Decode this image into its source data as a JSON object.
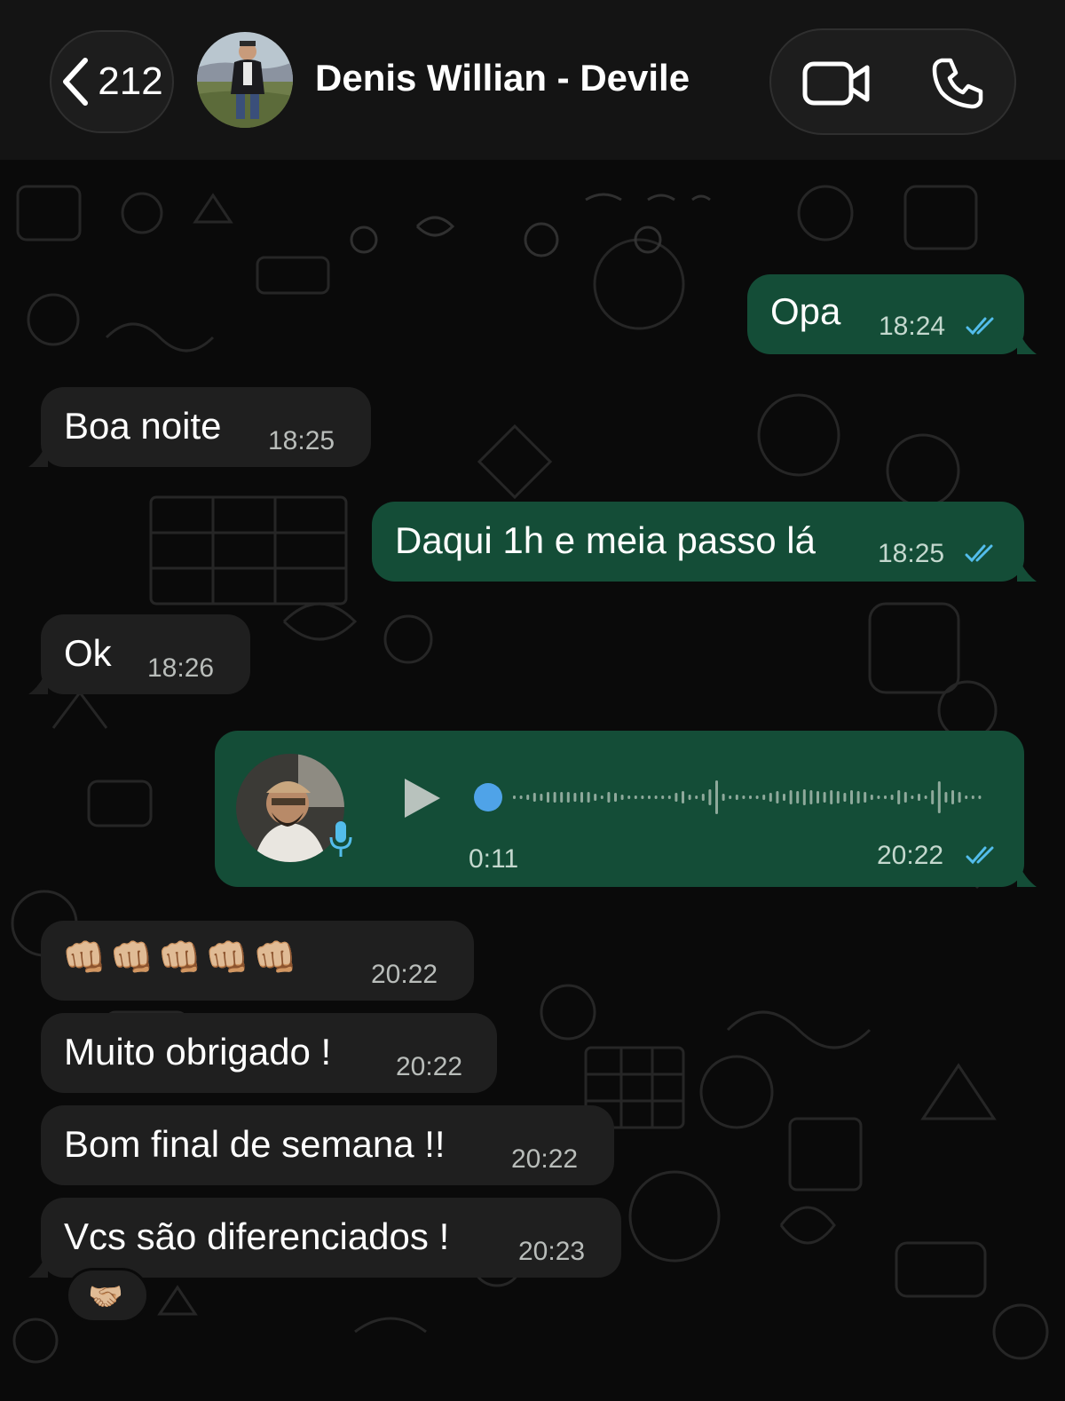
{
  "header": {
    "back_count": "212",
    "contact_name": "Denis Willian - Devile"
  },
  "colors": {
    "incoming_bubble": "#1f1f1f",
    "outgoing_bubble": "#144d37",
    "read_ticks": "#53bdeb",
    "voice_dot": "#4fa3e8"
  },
  "messages": [
    {
      "direction": "out",
      "text": "Opa",
      "time": "18:24",
      "status": "read"
    },
    {
      "direction": "in",
      "text": "Boa noite",
      "time": "18:25"
    },
    {
      "direction": "out",
      "text": "Daqui 1h e meia passo lá",
      "time": "18:25",
      "status": "read"
    },
    {
      "direction": "in",
      "text": "Ok",
      "time": "18:26"
    },
    {
      "direction": "out",
      "type": "voice",
      "duration": "0:11",
      "time": "20:22",
      "status": "read"
    },
    {
      "direction": "in",
      "text": "👊🏼👊🏼👊🏼👊🏼👊🏼",
      "time": "20:22"
    },
    {
      "direction": "in",
      "text": "Muito obrigado !",
      "time": "20:22"
    },
    {
      "direction": "in",
      "text": "Bom final de semana !!",
      "time": "20:22"
    },
    {
      "direction": "in",
      "text": "Vcs são diferenciados !",
      "time": "20:23",
      "reaction": "🤝🏼"
    }
  ],
  "icons": {
    "back": "chevron-left-icon",
    "video": "video-camera-icon",
    "call": "phone-icon",
    "play": "play-icon",
    "mic": "microphone-icon"
  }
}
